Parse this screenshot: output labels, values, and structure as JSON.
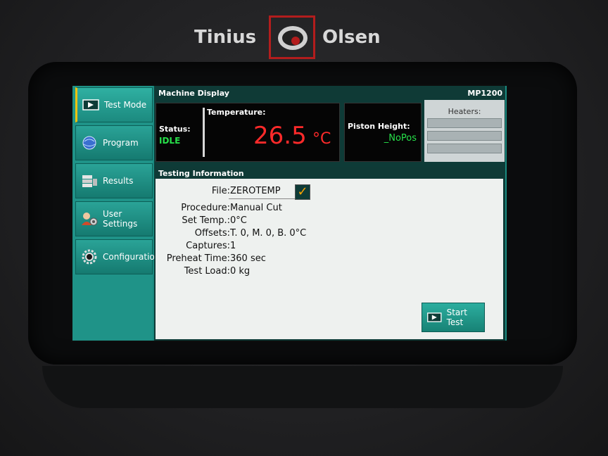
{
  "brand": {
    "left_word": "Tinius",
    "right_word": "Olsen"
  },
  "sidebar": {
    "items": [
      {
        "label": "Test Mode",
        "icon": "play-icon",
        "active": true
      },
      {
        "label": "Program",
        "icon": "globe-icon",
        "active": false
      },
      {
        "label": "Results",
        "icon": "results-icon",
        "active": false
      },
      {
        "label_line1": "User",
        "label_line2": "Settings",
        "icon": "user-settings-icon",
        "active": false
      },
      {
        "label": "Configuration",
        "icon": "gear-icon",
        "active": false
      }
    ]
  },
  "machine_display": {
    "title": "Machine Display",
    "model": "MP1200",
    "status_label": "Status:",
    "status_value": "IDLE",
    "temperature_label": "Temperature:",
    "temperature_value": "26.5",
    "temperature_unit": "°C",
    "piston_label": "Piston Height:",
    "piston_value": "_NoPos",
    "heaters_label": "Heaters:"
  },
  "testing_info": {
    "title": "Testing Information",
    "rows": [
      {
        "key": "File:",
        "value": "ZEROTEMP"
      },
      {
        "key": "Procedure:",
        "value": "Manual Cut"
      },
      {
        "key": "Set Temp.:",
        "value": "0°C"
      },
      {
        "key": "Offsets:",
        "value": "T. 0, M. 0, B. 0°C"
      },
      {
        "key": "Captures:",
        "value": "1"
      },
      {
        "key": "Preheat Time:",
        "value": "360 sec"
      },
      {
        "key": "Test Load:",
        "value": "0 kg"
      }
    ],
    "start_button": "Start Test"
  },
  "colors": {
    "status_green": "#27e04a",
    "temp_red": "#ff2a2a",
    "teal": "#1f9388",
    "active_accent": "#f1c40f"
  }
}
